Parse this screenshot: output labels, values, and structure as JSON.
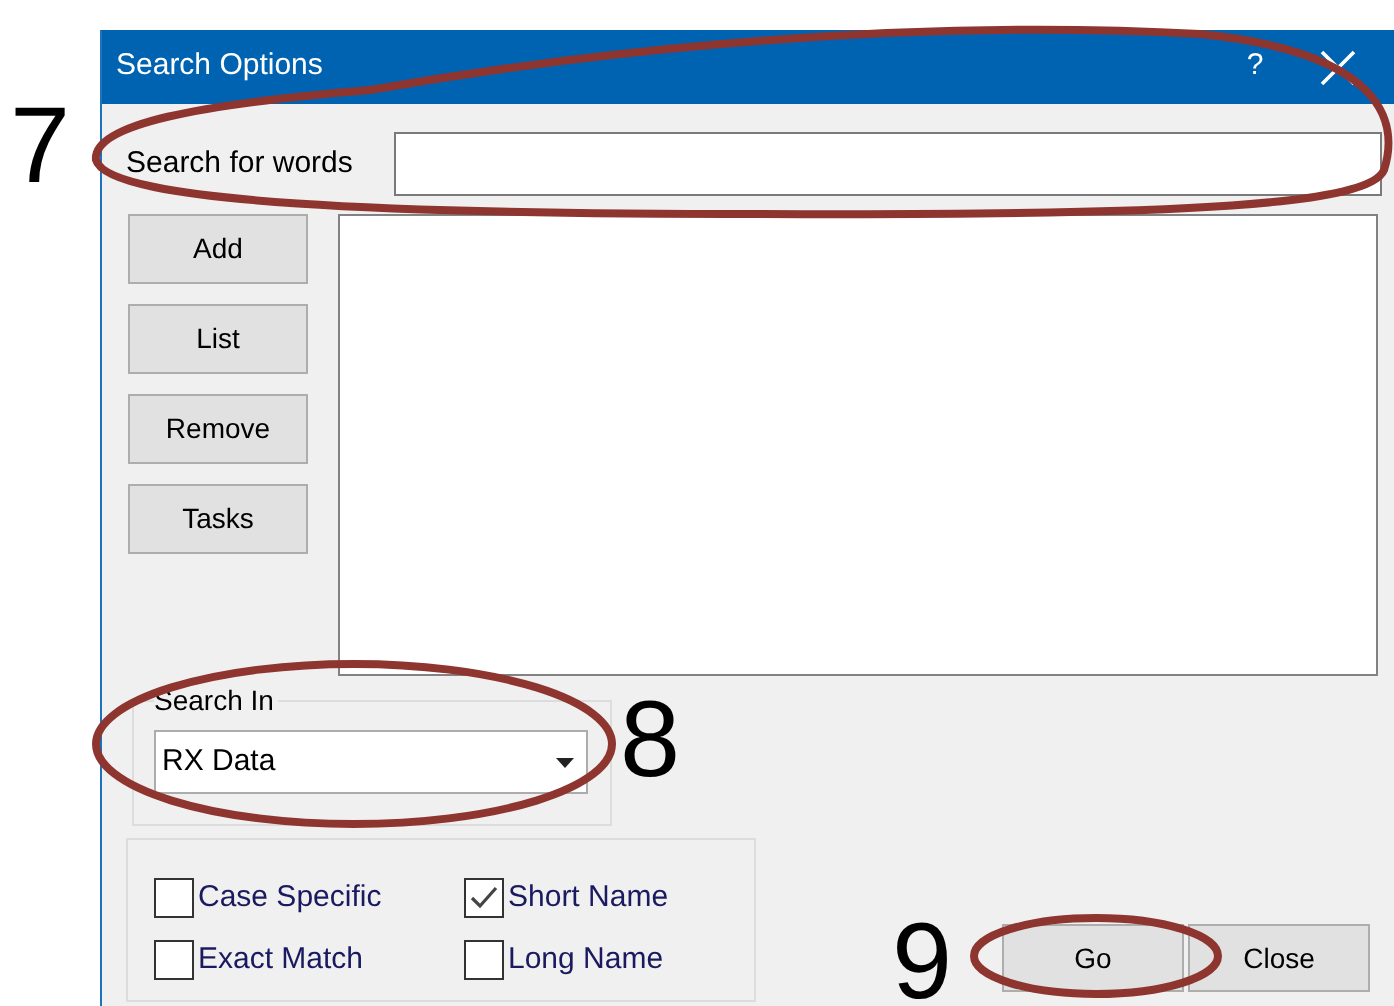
{
  "window": {
    "title": "Search Options",
    "help": "?"
  },
  "search_field": {
    "label": "Search for words"
  },
  "side_buttons": [
    "Add",
    "List",
    "Remove",
    "Tasks"
  ],
  "search_in": {
    "legend": "Search In",
    "value": "RX Data"
  },
  "options": [
    {
      "label": "Case Specific",
      "checked": false
    },
    {
      "label": "Short Name",
      "checked": true
    },
    {
      "label": "Exact Match",
      "checked": false
    },
    {
      "label": "Long Name",
      "checked": false
    }
  ],
  "buttons": [
    "Go",
    "Close"
  ],
  "annotations": [
    {
      "label": "7"
    },
    {
      "label": "8"
    },
    {
      "label": "9"
    }
  ]
}
